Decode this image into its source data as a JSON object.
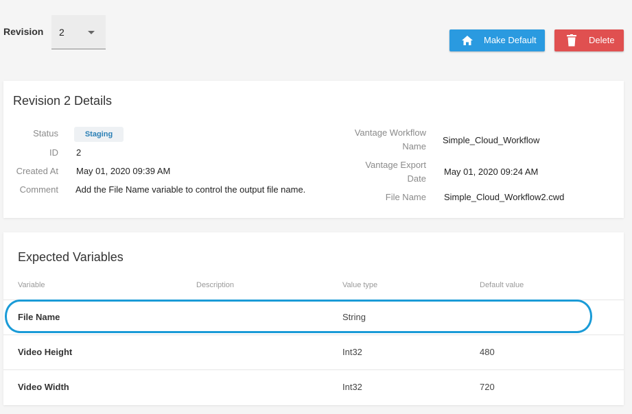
{
  "revision": {
    "label": "Revision",
    "selected": "2"
  },
  "toolbar": {
    "make_default_label": "Make Default",
    "delete_label": "Delete"
  },
  "details": {
    "title": "Revision 2 Details",
    "status_label": "Status",
    "status_value": "Staging",
    "id_label": "ID",
    "id_value": "2",
    "created_label": "Created At",
    "created_value": "May 01, 2020 09:39 AM",
    "comment_label": "Comment",
    "comment_value": "Add the File Name variable to control the output file name.",
    "workflow_label_1": "Vantage Workflow",
    "workflow_label_2": "Name",
    "workflow_value": "Simple_Cloud_Workflow",
    "export_label_1": "Vantage Export",
    "export_label_2": "Date",
    "export_value": "May 01, 2020 09:24 AM",
    "filename_label": "File Name",
    "filename_value": "Simple_Cloud_Workflow2.cwd"
  },
  "variables": {
    "title": "Expected Variables",
    "columns": [
      "Variable",
      "Description",
      "Value type",
      "Default value"
    ],
    "rows": [
      {
        "name": "File Name",
        "description": "",
        "type": "String",
        "default": ""
      },
      {
        "name": "Video Height",
        "description": "",
        "type": "Int32",
        "default": "480"
      },
      {
        "name": "Video Width",
        "description": "",
        "type": "Int32",
        "default": "720"
      }
    ]
  },
  "colors": {
    "primary": "#2a9ae0",
    "danger": "#e05050",
    "highlight": "#1a9bd7",
    "badge_text": "#2a7fb5"
  },
  "icons": {
    "make_default": "home-icon",
    "delete": "trash-icon",
    "dropdown": "caret-down-icon"
  }
}
